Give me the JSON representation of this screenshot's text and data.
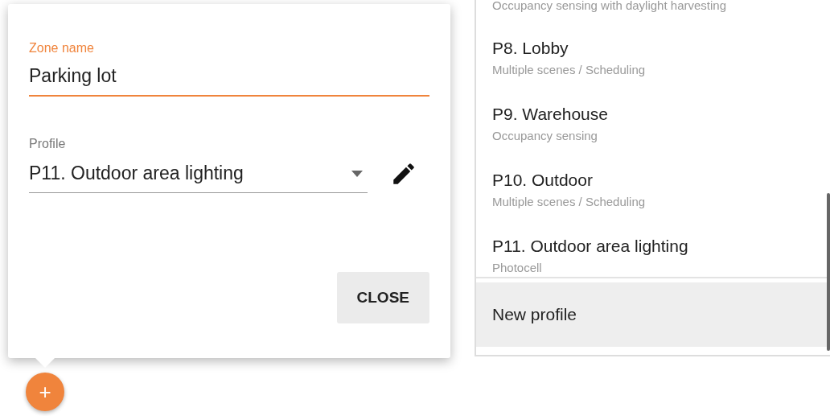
{
  "zone_card": {
    "zone_name": {
      "label": "Zone name",
      "value": "Parking lot",
      "focused": true
    },
    "profile": {
      "label": "Profile",
      "value": "P11. Outdoor area lighting"
    },
    "close_button": "CLOSE"
  },
  "profile_menu": {
    "cut_subtitle": "Occupancy sensing with daylight harvesting",
    "items": [
      {
        "title": "P8. Lobby",
        "subtitle": "Multiple scenes / Scheduling"
      },
      {
        "title": "P9. Warehouse",
        "subtitle": "Occupancy sensing"
      },
      {
        "title": "P10. Outdoor",
        "subtitle": "Multiple scenes / Scheduling"
      },
      {
        "title": "P11. Outdoor area lighting",
        "subtitle": "Photocell"
      }
    ],
    "new_profile": {
      "label": "New profile",
      "highlighted": true
    }
  },
  "fab": {
    "label": "+"
  }
}
